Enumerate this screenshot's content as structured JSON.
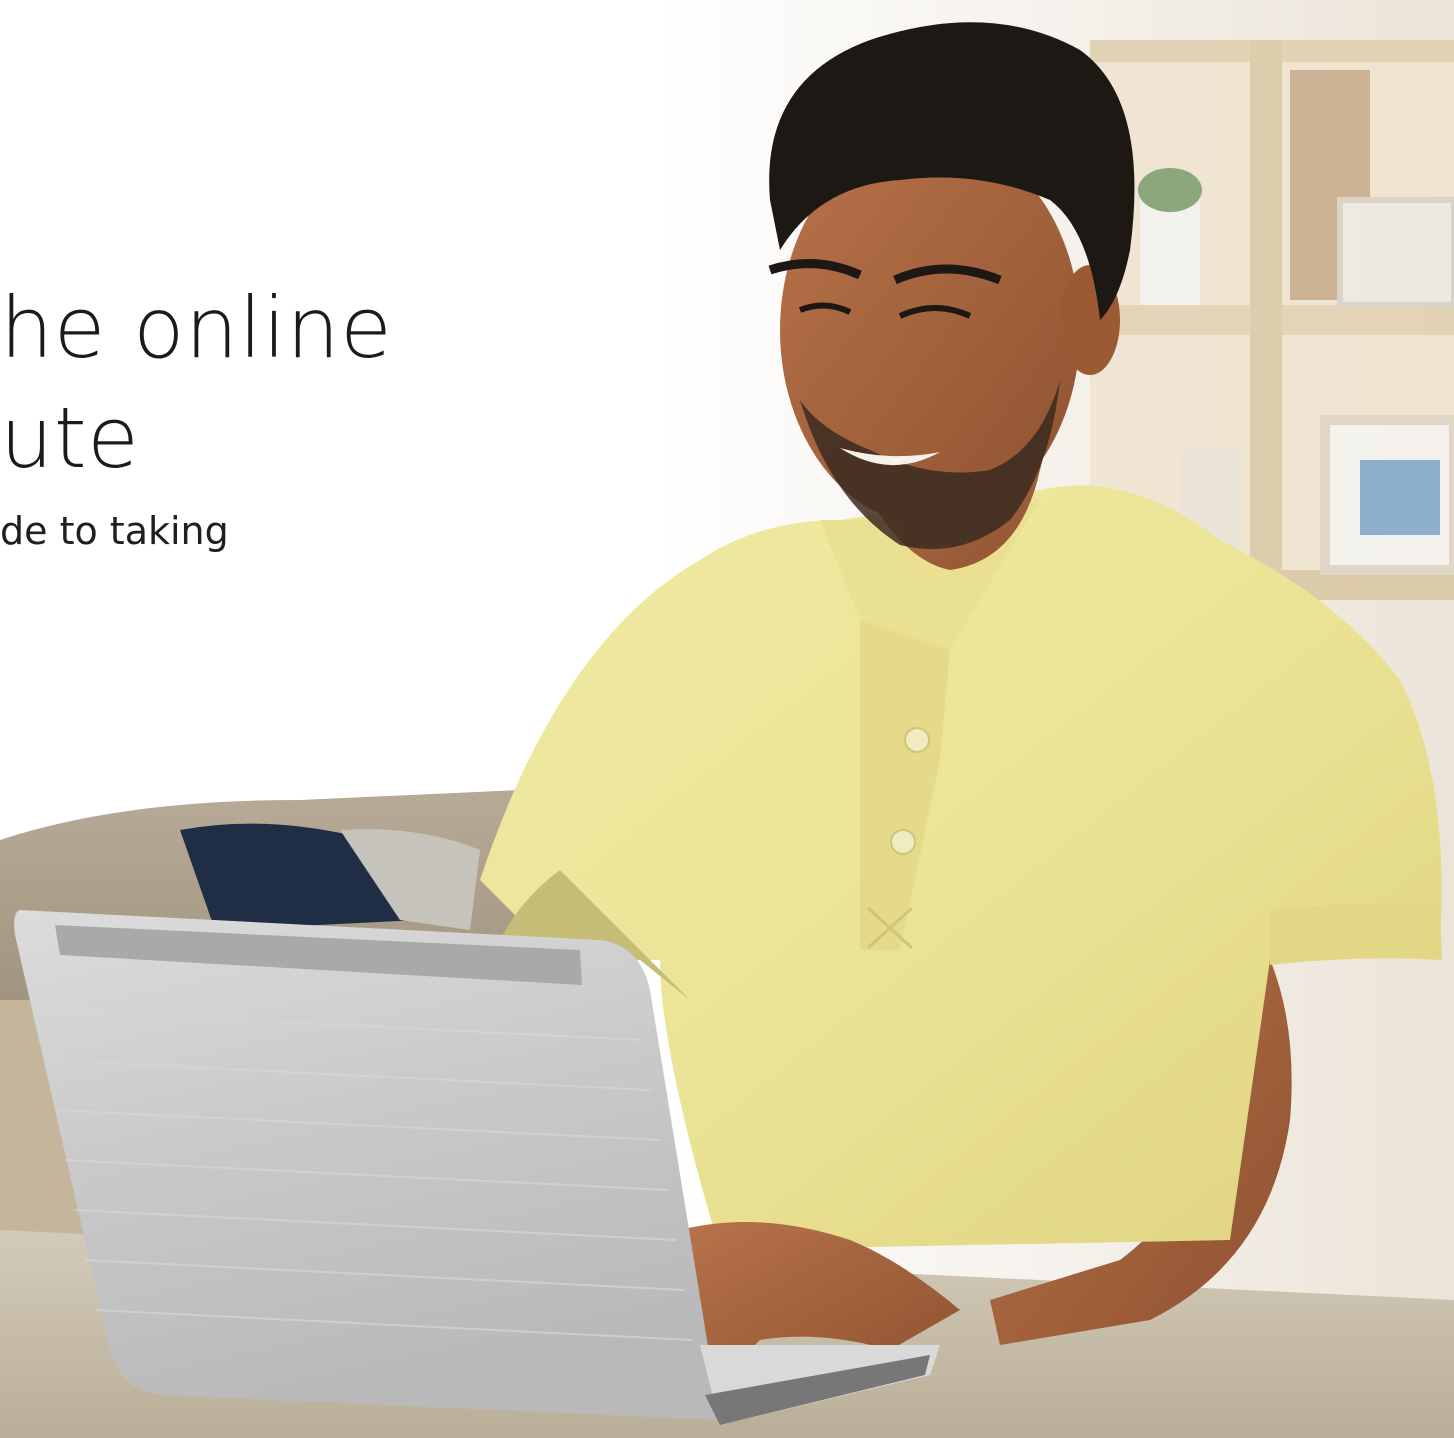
{
  "hero": {
    "headline_line1": "he online",
    "headline_line2": "ute",
    "subtitle": "de to taking"
  },
  "colors": {
    "text": "#1b1b1b",
    "shirt": "#ece596",
    "laptop": "#c9cacb",
    "skin": "#a8643c",
    "hair": "#1d1814",
    "shelf": "#e3d3b6",
    "table": "#c7bda9"
  },
  "photo": {
    "subject": "man-in-yellow-polo-typing-on-laptop-icon"
  }
}
